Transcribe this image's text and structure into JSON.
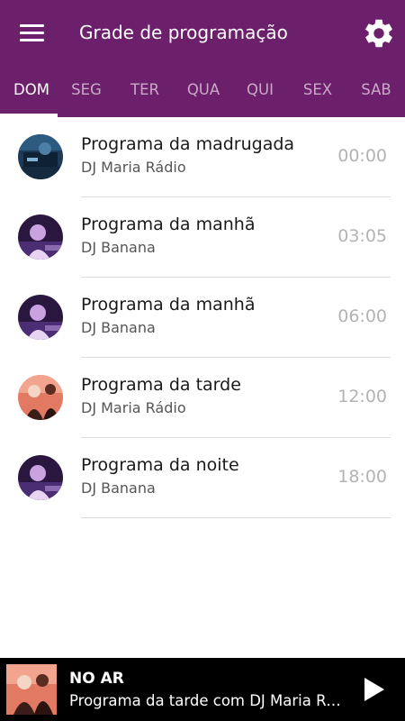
{
  "header": {
    "title": "Grade de programação",
    "menu_icon": "hamburger-menu-icon",
    "settings_icon": "gear-icon"
  },
  "tabs": [
    {
      "label": "DOM",
      "active": true
    },
    {
      "label": "SEG",
      "active": false
    },
    {
      "label": "TER",
      "active": false
    },
    {
      "label": "QUA",
      "active": false
    },
    {
      "label": "QUI",
      "active": false
    },
    {
      "label": "SEX",
      "active": false
    },
    {
      "label": "SAB",
      "active": false
    }
  ],
  "schedule": [
    {
      "title": "Programa da madrugada",
      "host": "DJ Maria Rádio",
      "time": "00:00"
    },
    {
      "title": "Programa da manhã",
      "host": "DJ Banana",
      "time": "03:05"
    },
    {
      "title": "Programa da manhã",
      "host": "DJ Banana",
      "time": "06:00"
    },
    {
      "title": "Programa da tarde",
      "host": "DJ Maria Rádio",
      "time": "12:00"
    },
    {
      "title": "Programa da noite",
      "host": "DJ Banana",
      "time": "18:00"
    }
  ],
  "player": {
    "label": "NO AR",
    "track": "Programa da tarde com DJ Maria Rádio",
    "play_icon": "play-icon"
  },
  "colors": {
    "header_bg": "#6c1f6a",
    "tab_inactive": "#c9a9c8",
    "tab_active": "#ffffff",
    "time_text": "#b3b3b3",
    "player_bg": "#000000"
  }
}
